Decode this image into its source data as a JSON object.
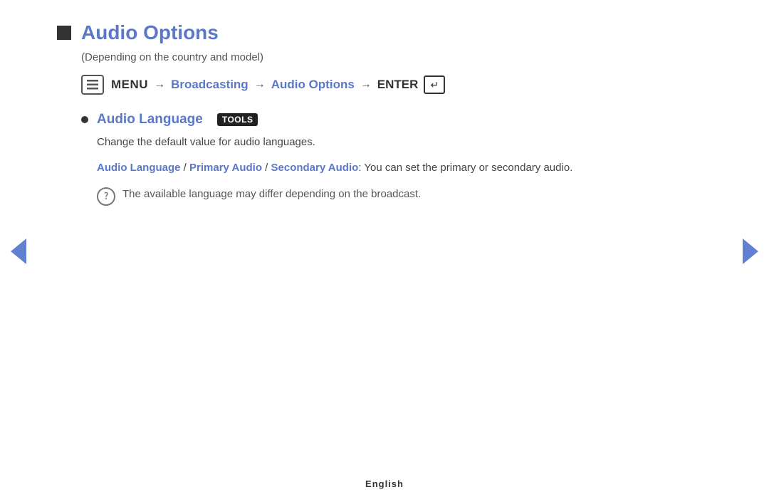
{
  "page": {
    "title": "Audio Options",
    "subtitle": "(Depending on the country and model)",
    "footer": "English"
  },
  "breadcrumb": {
    "menu_label": "MENU",
    "arrow1": "→",
    "broadcasting": "Broadcasting",
    "arrow2": "→",
    "audio_options": "Audio Options",
    "arrow3": "→",
    "enter_label": "ENTER"
  },
  "section": {
    "bullet_label": "Audio Language",
    "tools_badge": "TOOLS",
    "description": "Change the default value for audio languages.",
    "audio_language_link": "Audio Language",
    "slash1": " / ",
    "primary_audio_link": "Primary Audio",
    "slash2": " / ",
    "secondary_audio_link": "Secondary Audio",
    "options_suffix": ": You can set the primary or secondary audio.",
    "note": "The available language may differ depending on the broadcast."
  },
  "navigation": {
    "left_label": "previous",
    "right_label": "next"
  }
}
